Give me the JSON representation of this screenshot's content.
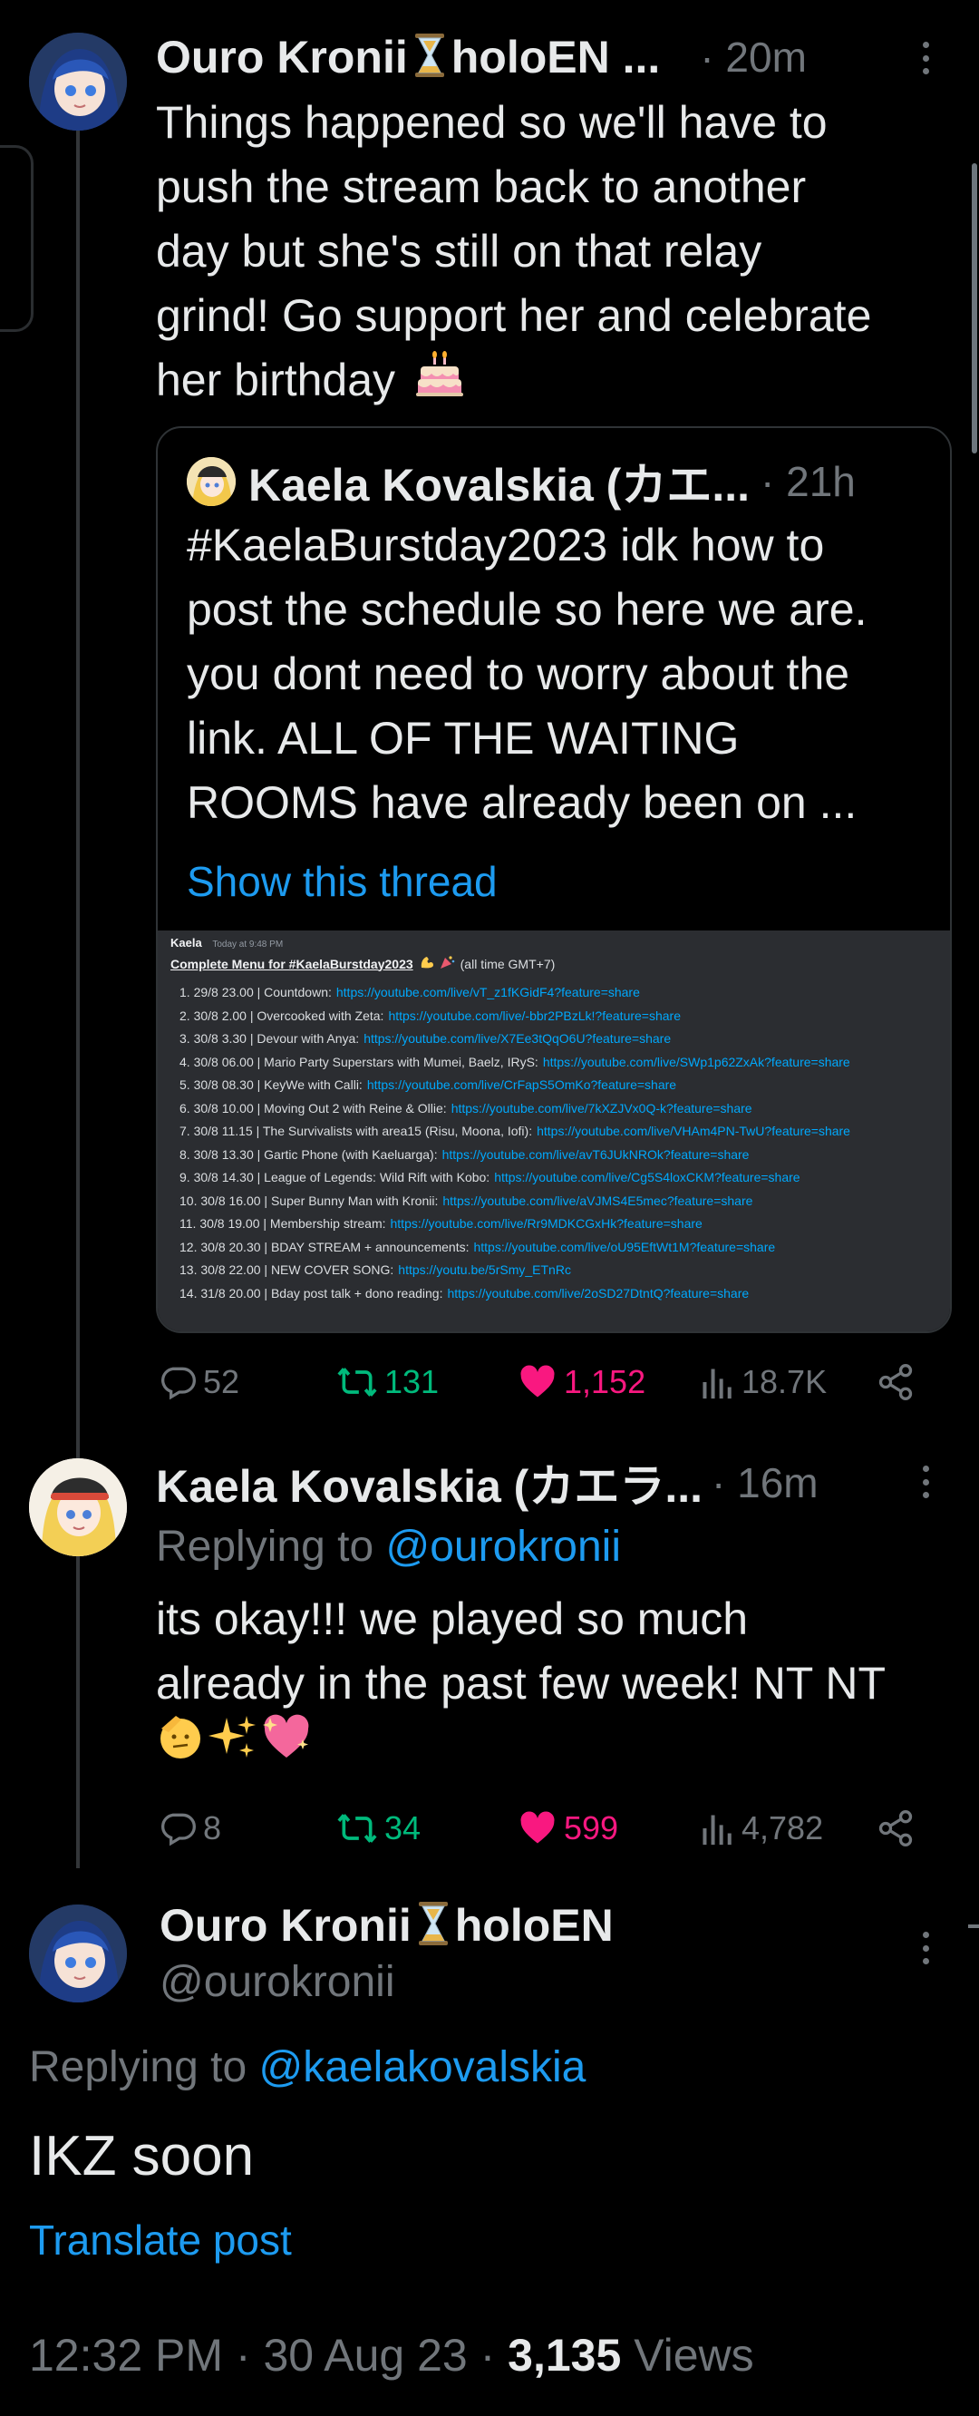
{
  "tweet1": {
    "display_name": "Ouro Kronii",
    "name_suffix": "holoEN ...",
    "time": "· 20m",
    "text_lines": [
      "Things happened so we'll have to",
      "push the stream back to another",
      "day but she's still on that relay",
      "grind! Go support her and celebrate",
      "her birthday"
    ],
    "quote": {
      "display_name": "Kaela Kovalskia (カエ...",
      "time": "· 21h",
      "text_lines": [
        "#KaelaBurstday2023 idk how to",
        "post the schedule so here we are.",
        "you dont need to worry about the",
        "link. ALL OF THE WAITING",
        "ROOMS have already been on ..."
      ],
      "show_thread": "Show this thread",
      "schedule": {
        "author": "Kaela",
        "timestamp": "Today at 9:48 PM",
        "title": "Complete Menu for #KaelaBurstday2023",
        "title_note": "(all time GMT+7)",
        "rows": [
          {
            "text": "1. 29/8 23.00 | Countdown:",
            "link": "https://youtube.com/live/vT_z1fKGidF4?feature=share"
          },
          {
            "text": "2. 30/8 2.00 | Overcooked with Zeta:",
            "link": "https://youtube.com/live/-bbr2PBzLk!?feature=share"
          },
          {
            "text": "3. 30/8 3.30 | Devour with Anya:",
            "link": "https://youtube.com/live/X7Ee3tQqO6U?feature=share"
          },
          {
            "text": "4. 30/8 06.00 | Mario Party Superstars with Mumei, Baelz, IRyS:",
            "link": "https://youtube.com/live/SWp1p62ZxAk?feature=share"
          },
          {
            "text": "5. 30/8 08.30 | KeyWe with Calli:",
            "link": "https://youtube.com/live/CrFapS5OmKo?feature=share"
          },
          {
            "text": "6. 30/8 10.00 | Moving Out 2 with Reine & Ollie:",
            "link": "https://youtube.com/live/7kXZJVx0Q-k?feature=share"
          },
          {
            "text": "7. 30/8 11.15 | The Survivalists with area15 (Risu, Moona, Iofi):",
            "link": "https://youtube.com/live/VHAm4PN-TwU?feature=share"
          },
          {
            "text": "8. 30/8 13.30 | Gartic Phone (with Kaeluarga):",
            "link": "https://youtube.com/live/avT6JUkNROk?feature=share"
          },
          {
            "text": "9. 30/8 14.30 | League of Legends: Wild Rift with Kobo:",
            "link": "https://youtube.com/live/Cg5S4loxCKM?feature=share"
          },
          {
            "text": "10. 30/8 16.00 | Super Bunny Man with Kronii:",
            "link": "https://youtube.com/live/aVJMS4E5mec?feature=share"
          },
          {
            "text": "11. 30/8 19.00 | Membership stream:",
            "link": "https://youtube.com/live/Rr9MDKCGxHk?feature=share"
          },
          {
            "text": "12. 30/8 20.30 | BDAY STREAM + announcements:",
            "link": "https://youtube.com/live/oU95EftWt1M?feature=share"
          },
          {
            "text": "13. 30/8 22.00 | NEW COVER SONG:",
            "link": "https://youtu.be/5rSmy_ETnRc"
          },
          {
            "text": "14. 31/8 20.00 | Bday post talk + dono reading:",
            "link": "https://youtube.com/live/2oSD27DtntQ?feature=share"
          }
        ]
      }
    },
    "stats": {
      "replies": "52",
      "reposts": "131",
      "likes": "1,152",
      "views": "18.7K"
    }
  },
  "tweet2": {
    "display_name": "Kaela Kovalskia (カエラ...",
    "time": "· 16m",
    "replying_prefix": "Replying to",
    "replying_handle": "@ourokronii",
    "text_lines": [
      "its okay!!! we played so much",
      "already in the past few week! NT NT"
    ],
    "stats": {
      "replies": "8",
      "reposts": "34",
      "likes": "599",
      "views": "4,782"
    }
  },
  "tweet3": {
    "display_name": "Ouro Kronii",
    "name_suffix": "holoEN",
    "handle": "@ourokronii",
    "replying_prefix": "Replying to",
    "replying_handle": "@kaelakovalskia",
    "text": "IKZ soon",
    "translate": "Translate post",
    "time": "12:32 PM",
    "date": "30 Aug 23",
    "views_count": "3,135",
    "views_label": "Views"
  },
  "colors": {
    "background": "#000000",
    "text": "#e7e9ea",
    "muted": "#71767b",
    "link": "#1d9bf0",
    "repost": "#00ba7c",
    "like": "#f91880",
    "border": "#2f3336"
  },
  "icons": [
    "more-icon",
    "reply-icon",
    "repost-icon",
    "like-icon",
    "views-icon",
    "share-icon",
    "hourglass-icon",
    "cake-emoji"
  ]
}
